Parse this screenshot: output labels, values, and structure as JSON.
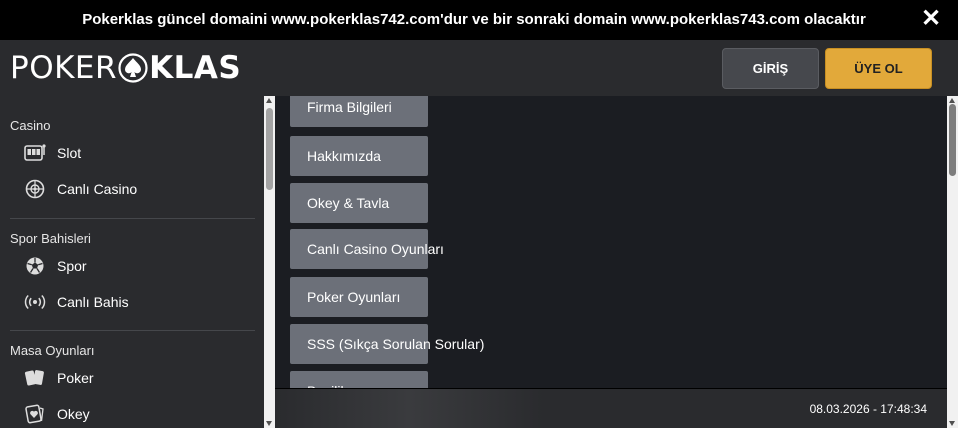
{
  "announcement": "Pokerklas güncel domaini www.pokerklas742.com'dur ve bir sonraki domain www.pokerklas743.com olacaktır",
  "logo": {
    "part1": "POKER",
    "part2": "KLAS"
  },
  "header": {
    "login_label": "GİRİŞ",
    "signup_label": "ÜYE OL"
  },
  "sidebar": {
    "sections": [
      {
        "title": "Casino",
        "items": [
          {
            "label": "Slot",
            "icon": "slot-machine-icon"
          },
          {
            "label": "Canlı Casino",
            "icon": "roulette-icon"
          }
        ]
      },
      {
        "title": "Spor Bahisleri",
        "items": [
          {
            "label": "Spor",
            "icon": "soccer-ball-icon"
          },
          {
            "label": "Canlı Bahis",
            "icon": "live-broadcast-icon"
          }
        ]
      },
      {
        "title": "Masa Oyunları",
        "items": [
          {
            "label": "Poker",
            "icon": "cards-icon"
          },
          {
            "label": "Okey",
            "icon": "heart-card-icon"
          }
        ]
      }
    ]
  },
  "menu": [
    "Firma Bilgileri",
    "Hakkımızda",
    "Okey & Tavla",
    "Canlı Casino Oyunları",
    "Poker Oyunları",
    "SSS (Sıkça Sorulan Sorular)",
    "Bayilik"
  ],
  "footer": {
    "datetime": "08.03.2026 - 17:48:34"
  },
  "colors": {
    "accent": "#e2a93a",
    "menu_button": "#6c7079",
    "background": "#1b1d22",
    "panel": "#2a2b2e"
  }
}
